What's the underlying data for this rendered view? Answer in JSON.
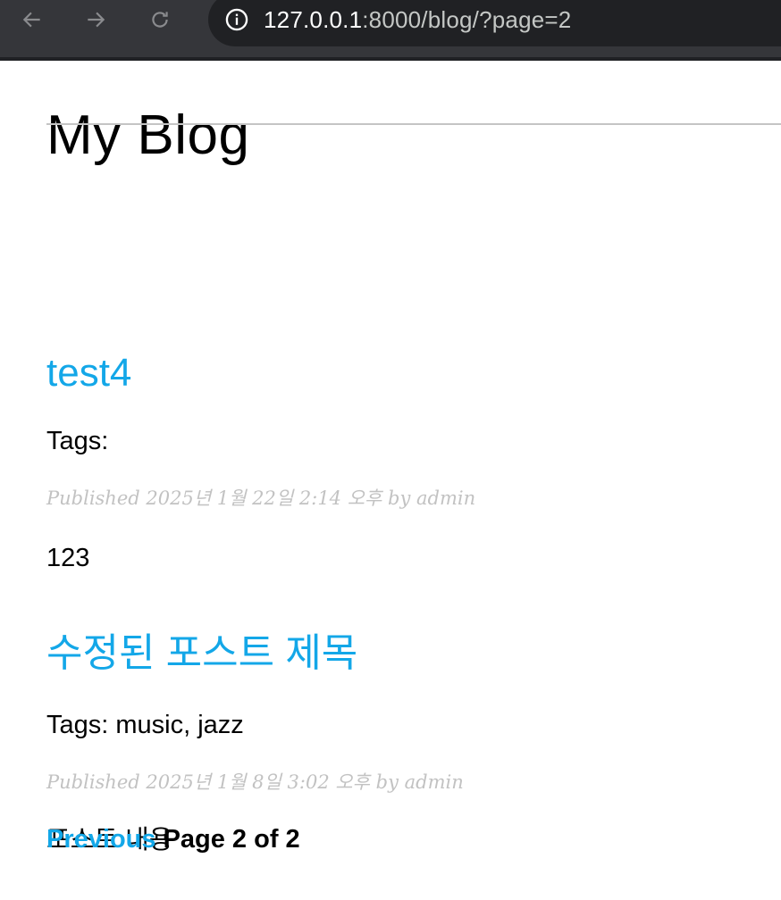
{
  "browser": {
    "url_host": "127.0.0.1",
    "url_path": ":8000/blog/?page=2",
    "icons": {
      "back": "arrow-left-icon",
      "forward": "arrow-right-icon",
      "reload": "reload-icon",
      "site_info": "info-icon"
    }
  },
  "site": {
    "title": "My Blog"
  },
  "posts": [
    {
      "title": "test4",
      "tags": "Tags:",
      "published": "Published 2025년 1월 22일 2:14 오후 by admin",
      "body": "123"
    },
    {
      "title": "수정된 포스트 제목",
      "tags": "Tags: music, jazz",
      "published": "Published 2025년 1월 8일 3:02 오후 by admin",
      "body": "포스트 내용"
    }
  ],
  "pagination": {
    "previous_label": "Previous",
    "current_label": "Page 2 of 2"
  },
  "colors": {
    "link": "#13a7e8",
    "meta": "#c2c2c2",
    "toolbar": "#35363a",
    "omnibox": "#202124"
  }
}
